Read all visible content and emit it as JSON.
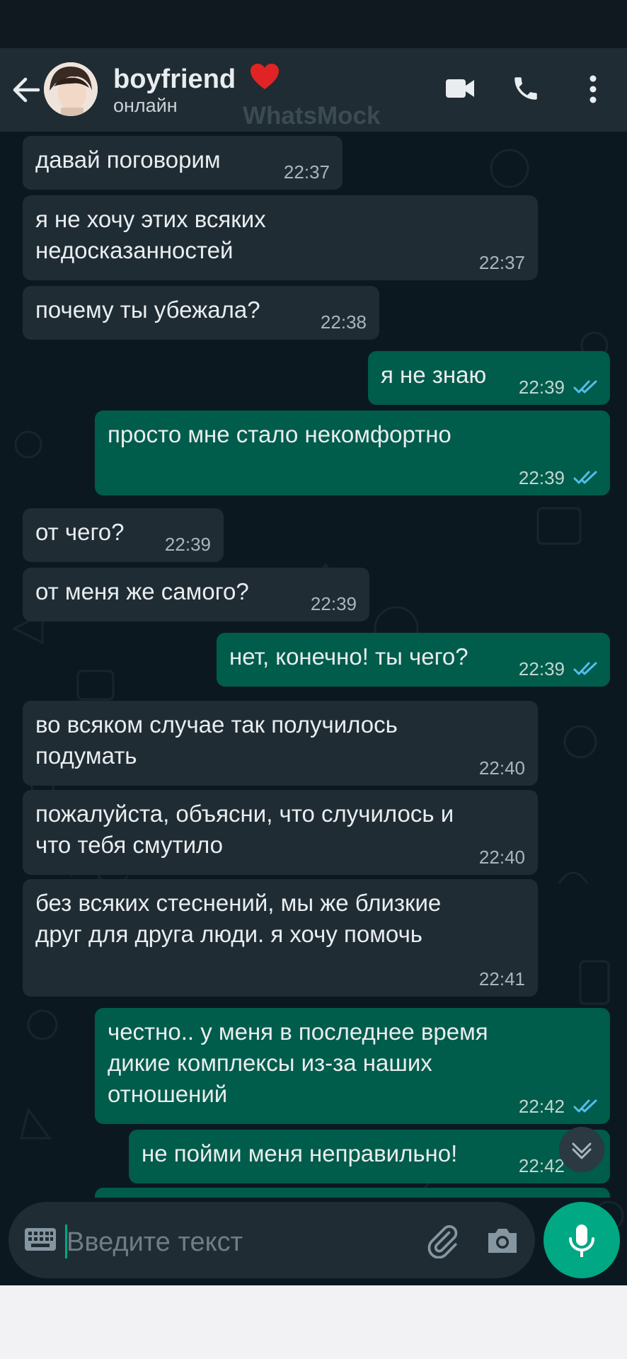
{
  "header": {
    "contact_name": "boyfriend",
    "status": "онлайн",
    "watermark": "WhatsMock"
  },
  "messages": [
    {
      "dir": "in",
      "text": "давай поговорим",
      "time": "22:37"
    },
    {
      "dir": "in",
      "text": "я не хочу этих всяких\nнедосказанностей",
      "time": "22:37"
    },
    {
      "dir": "in",
      "text": "почему ты убежала?",
      "time": "22:38"
    },
    {
      "dir": "out",
      "text": "я не знаю",
      "time": "22:39",
      "read": true
    },
    {
      "dir": "out",
      "text": "просто мне стало некомфортно",
      "time": "22:39",
      "read": true
    },
    {
      "dir": "in",
      "text": "от чего?",
      "time": "22:39"
    },
    {
      "dir": "in",
      "text": "от меня же самого?",
      "time": "22:39"
    },
    {
      "dir": "out",
      "text": "нет, конечно! ты чего?",
      "time": "22:39",
      "read": true
    },
    {
      "dir": "in",
      "text": "во всяком случае так получилось\nподумать",
      "time": "22:40"
    },
    {
      "dir": "in",
      "text": "пожалуйста, объясни, что случилось и\nчто тебя смутило",
      "time": "22:40"
    },
    {
      "dir": "in",
      "text": "без всяких стеснений, мы же близкие\nдруг для друга люди. я хочу помочь",
      "time": "22:41"
    },
    {
      "dir": "out",
      "text": "честно.. у меня в последнее время\nдикие комплексы из-за наших\nотношений",
      "time": "22:42",
      "read": true
    },
    {
      "dir": "out",
      "text": "не пойми меня неправильно!",
      "time": "22:42",
      "read": true
    }
  ],
  "input": {
    "placeholder": "Введите текст"
  },
  "colors": {
    "incoming": "#1f2c34",
    "outgoing": "#005c4b",
    "accent": "#00a884",
    "read_ticks": "#53bdeb"
  },
  "icons": [
    "back-arrow-icon",
    "video-call-icon",
    "phone-icon",
    "more-vert-icon",
    "keyboard-icon",
    "attach-icon",
    "camera-icon",
    "mic-icon",
    "chevron-down-icon",
    "heart-icon"
  ]
}
